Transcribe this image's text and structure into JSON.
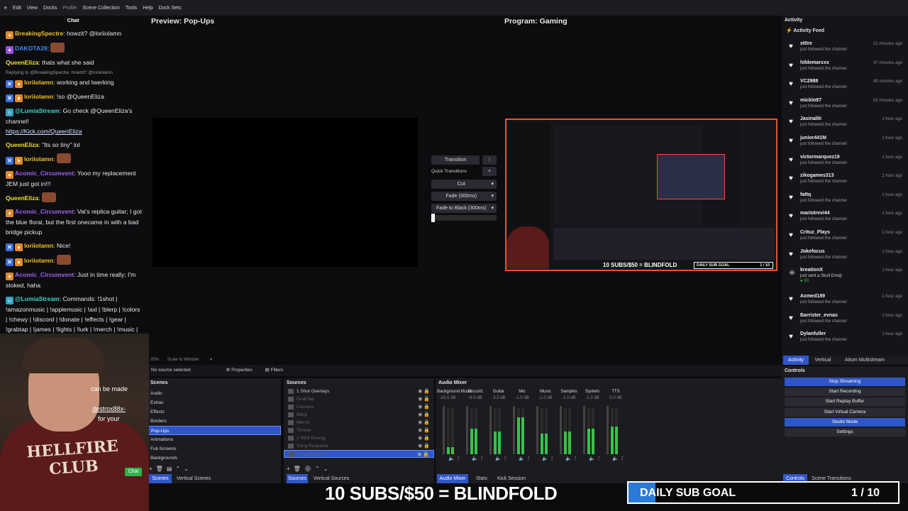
{
  "menubar": {
    "items": [
      "e",
      "Edit",
      "View",
      "Docks",
      "Profile",
      "Scene Collection",
      "Tools",
      "Help",
      "Dock Sets"
    ]
  },
  "chat": {
    "title": "Chat",
    "messages": [
      {
        "user": "BreakingSpectre",
        "color": "#f0c020",
        "badges": [
          "orange"
        ],
        "text": ": howzit? @loriiolamn"
      },
      {
        "user": "DAKOTA39",
        "color": "#3c8cf0",
        "badges": [
          "purple"
        ],
        "text": ":",
        "emote": true
      },
      {
        "user": "QueenEliza",
        "color": "#f0e020",
        "badges": [],
        "text": ": thats what she said"
      },
      {
        "reply": "Replying to @BreakingSpectre: howzit? @loriiolamn"
      },
      {
        "user": "loriiolamn",
        "color": "#f0c020",
        "badges": [
          "blue",
          "orange"
        ],
        "text": ": working and twerking"
      },
      {
        "user": "loriiolamn",
        "color": "#f0c020",
        "badges": [
          "blue",
          "orange"
        ],
        "text": ": !so @QueenEliza"
      },
      {
        "user": "@LumiaStream",
        "color": "#3fd6c6",
        "badges": [
          "teal"
        ],
        "text": ": Go check @QueenEliza's channel!",
        "link": "https://Kick.com/QueenEliza"
      },
      {
        "user": "QueenEliza",
        "color": "#f0e020",
        "badges": [],
        "text": ": \"Its so tiny\" lol"
      },
      {
        "user": "loriiolamn",
        "color": "#f0c020",
        "badges": [
          "blue",
          "orange"
        ],
        "text": ":",
        "emote": true
      },
      {
        "user": "Acomic_Circumvent",
        "color": "#a060f0",
        "badges": [
          "orange"
        ],
        "text": ": Yooo my replacement JEM just got in!!!"
      },
      {
        "user": "QueenEliza",
        "color": "#f0e020",
        "badges": [],
        "text": ":",
        "emote": true
      },
      {
        "user": "Acomic_Circumvent",
        "color": "#a060f0",
        "badges": [
          "orange"
        ],
        "text": ": Vai's replica guitar; I got the blue floral, but the first onecame in with a bad bridge pickup"
      },
      {
        "user": "loriiolamn",
        "color": "#f0c020",
        "badges": [
          "blue",
          "orange"
        ],
        "text": ": Nice!"
      },
      {
        "user": "loriiolamn",
        "color": "#f0c020",
        "badges": [
          "blue",
          "orange"
        ],
        "text": ":",
        "emote": true
      },
      {
        "user": "Acomic_Circumvent",
        "color": "#a060f0",
        "badges": [
          "orange"
        ],
        "text": ": Just in time really; I'm stoked, haha"
      },
      {
        "user": "@LumiaStream",
        "color": "#3fd6c6",
        "badges": [
          "teal"
        ],
        "text": ": Commands: !1shot | !amazonmusic | !applemusic | !axl | !blerp | !colors | !chewy | !discord | !donate | !effects | !gear | !grabtap | !james | !lights | !lurk | !merch | !music | !overlays | !podcast | !schedule | !superchord | !socials | !songlist | !so | !spotify | !throne | !tim |"
      }
    ],
    "partial1": "can be made",
    "partial2": "destrox88x-",
    "partial3": "for your",
    "chat_button": "Chat"
  },
  "webcam": {
    "shirt_text": "HELLFIRE CLUB"
  },
  "preview": {
    "title": "Preview: Pop-Ups",
    "zoom": "35%",
    "scale": "Scale to Window"
  },
  "program": {
    "title": "Program: Gaming",
    "inner_caption": "10 SUBS/$50 = BLINDFOLD",
    "inner_goal": "DAILY SUB GOAL",
    "inner_count": "1 / 10"
  },
  "transitions": {
    "transition": "Transition",
    "quick": "Quick Transitions",
    "cut": "Cut",
    "fade": "Fade (300ms)",
    "fade_black": "Fade to Black (300ms)"
  },
  "source_bar": {
    "no_source": "No source selected",
    "properties": "Properties",
    "filters": "Filters"
  },
  "activity": {
    "title": "Activity",
    "feed": "Activity Feed",
    "items": [
      {
        "name": "st0re",
        "sub": "just followed the channel",
        "time": "21 minutes ago"
      },
      {
        "name": "hildemarxxx",
        "sub": "just followed the channel",
        "time": "47 minutes ago"
      },
      {
        "name": "VC2988",
        "sub": "just followed the channel",
        "time": "48 minutes ago"
      },
      {
        "name": "micklo97",
        "sub": "just followed the channel",
        "time": "52 minutes ago"
      },
      {
        "name": "Jasinaliti",
        "sub": "just followed the channel",
        "time": "1 hour ago"
      },
      {
        "name": "junior441M",
        "sub": "just followed the channel",
        "time": "1 hour ago"
      },
      {
        "name": "victormarquez19",
        "sub": "just followed the channel",
        "time": "1 hour ago"
      },
      {
        "name": "zikogames313",
        "sub": "just followed the channel",
        "time": "1 hour ago"
      },
      {
        "name": "fattq",
        "sub": "just followed the channel",
        "time": "1 hour ago"
      },
      {
        "name": "mariotrevi44",
        "sub": "just followed the channel",
        "time": "1 hour ago"
      },
      {
        "name": "Crituz_Plays",
        "sub": "just followed the channel",
        "time": "1 hour ago"
      },
      {
        "name": "Jokefocus",
        "sub": "just followed the channel",
        "time": "1 hour ago"
      },
      {
        "name": "kreationX",
        "sub": "just sent a Skull Emoji",
        "time": "1 hour ago",
        "extra": "50"
      },
      {
        "name": "Axmed189",
        "sub": "just followed the channel",
        "time": "1 hour ago"
      },
      {
        "name": "Barrister_evnas",
        "sub": "just followed the channel",
        "time": "1 hour ago"
      },
      {
        "name": "Dylanfuller",
        "sub": "just followed the channel",
        "time": "1 hour ago"
      }
    ],
    "tabs": [
      "Activity",
      "Vertical",
      "Aitum Multistream"
    ]
  },
  "controls": {
    "title": "Controls",
    "buttons": [
      "Stop Streaming",
      "Start Recording",
      "Start Replay Buffer",
      "Start Virtual Camera",
      "Studio Mode",
      "Settings"
    ],
    "tabs": [
      "Controls",
      "Scene Transitions"
    ]
  },
  "scenes": {
    "title": "Scenes",
    "items": [
      "Audio",
      "Extras",
      "Effects",
      "Borders",
      "Pop-Ups",
      "Animations",
      "Full-Screens",
      "Backgrounds"
    ],
    "selected": 4,
    "tabs": [
      "Scenes",
      "Vertical Scenes"
    ]
  },
  "sources": {
    "title": "Sources",
    "items": [
      "1 Shot Overlays",
      "GrabTap",
      "Lessons",
      "Blerp",
      "Merch",
      "Throne",
      "1 Shot Energy",
      "Song Requests",
      "Song Request"
    ],
    "tabs": [
      "Sources",
      "Vertical Sources"
    ]
  },
  "mixer": {
    "title": "Audio Mixer",
    "channels": [
      {
        "name": "Background Music",
        "db": "-20.0 dB",
        "level": 0.15
      },
      {
        "name": "Discord",
        "db": "-6.0 dB",
        "level": 0.55
      },
      {
        "name": "Guitar",
        "db": "-3.5 dB",
        "level": 0.5
      },
      {
        "name": "Mic",
        "db": "-1.0 dB",
        "level": 0.8
      },
      {
        "name": "Music",
        "db": "-1.0 dB",
        "level": 0.45
      },
      {
        "name": "Samples",
        "db": "-1.0 dB",
        "level": 0.5
      },
      {
        "name": "System",
        "db": "-1.0 dB",
        "level": 0.55
      },
      {
        "name": "TTS",
        "db": "0.0 dB",
        "level": 0.6
      }
    ],
    "tabs": [
      "Audio Mixer",
      "Stats",
      "Kick Session"
    ]
  },
  "overlay": {
    "caption": "10 SUBS/$50 = BLINDFOLD",
    "goal_label": "DAILY SUB GOAL",
    "goal_count": "1 / 10",
    "progress": 0.1
  }
}
